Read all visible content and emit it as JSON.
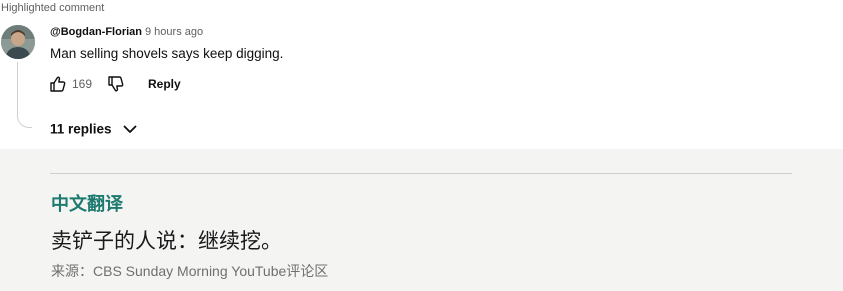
{
  "comment": {
    "highlight_label": "Highlighted comment",
    "author": "@Bogdan-Florian",
    "time": "9 hours ago",
    "text": "Man selling shovels says keep digging.",
    "like_count": "169",
    "reply_label": "Reply",
    "replies_label": "11 replies",
    "icons": [
      "thumb-up-icon",
      "thumb-down-icon",
      "chevron-down-icon"
    ]
  },
  "translation": {
    "title": "中文翻译",
    "text": "卖铲子的人说：继续挖。",
    "source": "来源：CBS Sunday Morning YouTube评论区"
  },
  "colors": {
    "accent_green": "#1d7a6f",
    "panel_bg": "#f4f4f3"
  }
}
